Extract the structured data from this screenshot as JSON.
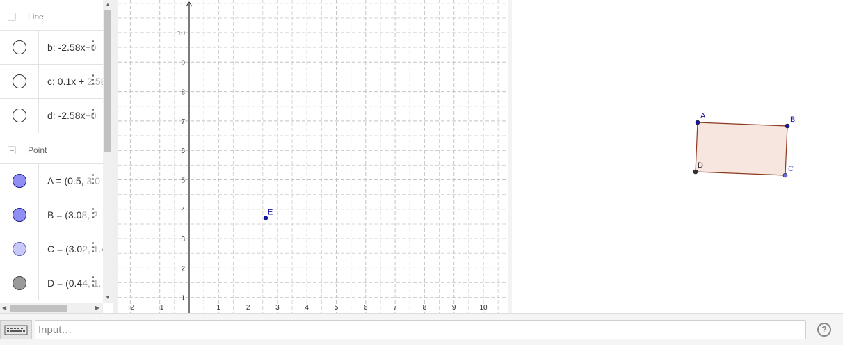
{
  "algebra": {
    "groups": [
      {
        "name": "Line",
        "items": [
          {
            "text": "b: -2.58x",
            "dim": "+0",
            "color": "#ffffff",
            "border": "#333333"
          },
          {
            "text": "c: 0.1x + ",
            "dim": "2.58",
            "color": "#ffffff",
            "border": "#333333"
          },
          {
            "text": "d: -2.58x",
            "dim": "+0",
            "color": "#ffffff",
            "border": "#333333"
          }
        ]
      },
      {
        "name": "Point",
        "items": [
          {
            "text": "A = (0.5, ",
            "dim": "3.0",
            "color": "#8e8ef5",
            "border": "#1a1a8c"
          },
          {
            "text": "B = (3.0",
            "dim": "8, 2.",
            "color": "#8e8ef5",
            "border": "#1a1a8c"
          },
          {
            "text": "C = (3.0",
            "dim": "2, 1.4",
            "color": "#c8c8fa",
            "border": "#5a5ab4"
          },
          {
            "text": "D = (0.4",
            "dim": "4, 1.",
            "color": "#9a9a9a",
            "border": "#444444"
          }
        ]
      }
    ]
  },
  "graphics": {
    "x_ticks": [
      "−2",
      "−1",
      "1",
      "2",
      "3",
      "4",
      "5",
      "6",
      "7",
      "8",
      "9",
      "10"
    ],
    "y_ticks": [
      "1",
      "2",
      "3",
      "4",
      "5",
      "6",
      "7",
      "8",
      "9",
      "10"
    ],
    "point_E": {
      "label": "E",
      "color": "#1515a0"
    }
  },
  "graphics2": {
    "points": [
      {
        "label": "A",
        "color": "#1515a0"
      },
      {
        "label": "B",
        "color": "#1515a0"
      },
      {
        "label": "C",
        "color": "#6a6ad8"
      },
      {
        "label": "D",
        "color": "#333333"
      }
    ],
    "fill": "#f7e5e0",
    "stroke": "#8b3a1e"
  },
  "input": {
    "placeholder": "Input…"
  },
  "help": {
    "symbol": "?"
  }
}
